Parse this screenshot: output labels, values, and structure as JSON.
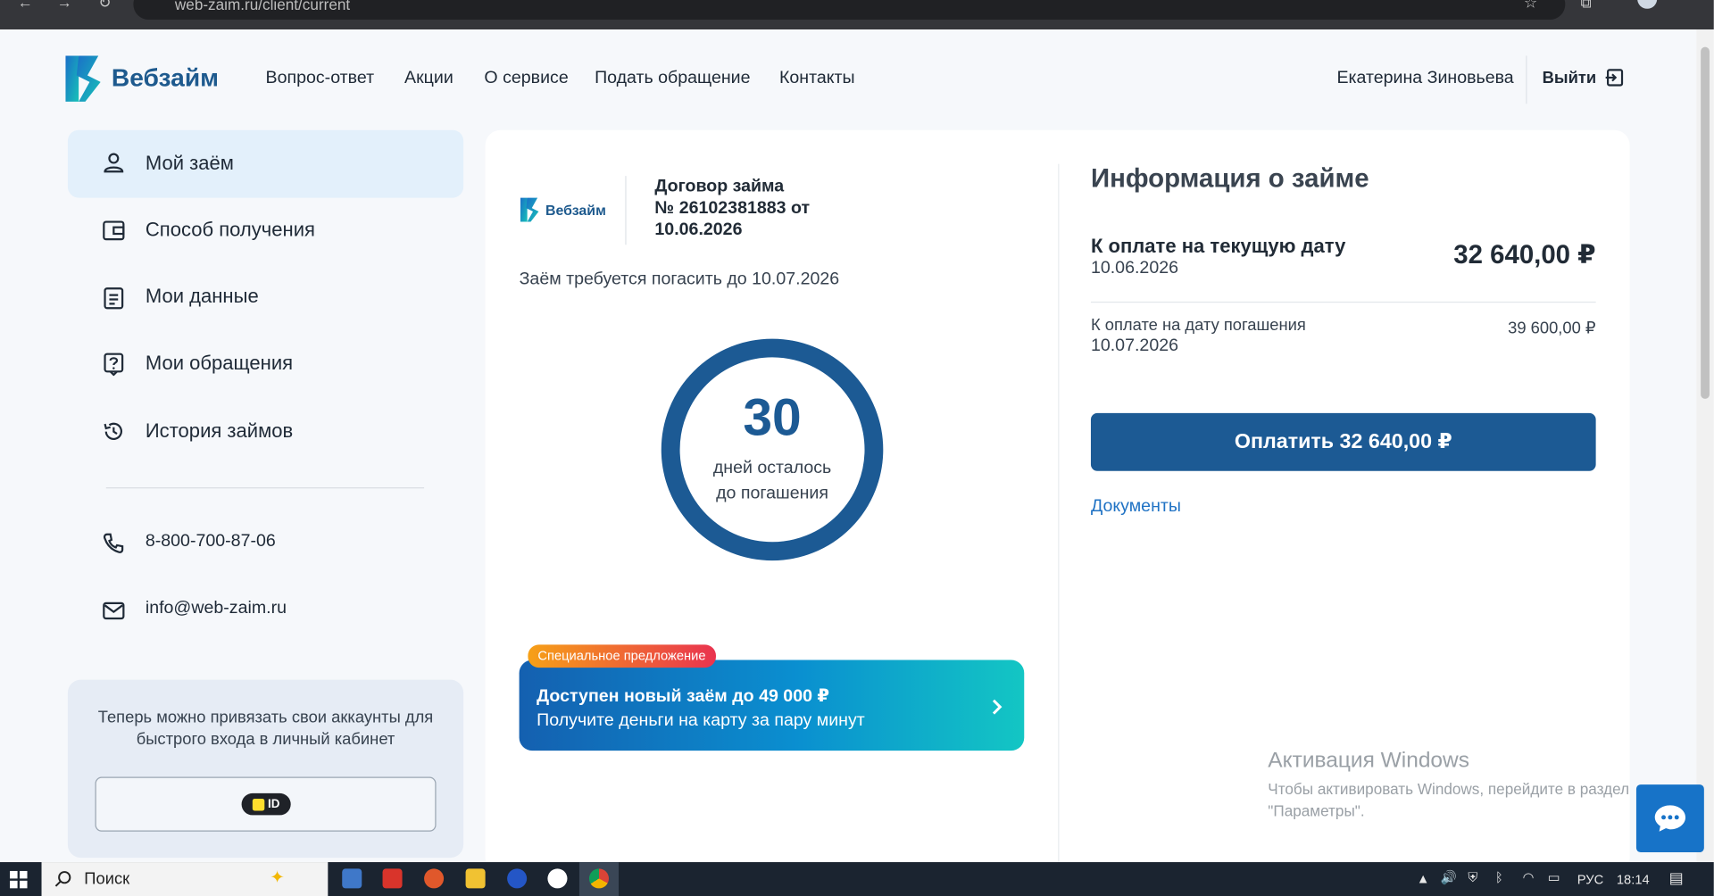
{
  "browser": {
    "url": "web-zaim.ru/client/current"
  },
  "header": {
    "brand": "Вебзайм",
    "nav": [
      "Вопрос-ответ",
      "Акции",
      "О сервисе",
      "Подать обращение",
      "Контакты"
    ],
    "user_name": "Екатерина Зиновьева",
    "logout_label": "Выйти"
  },
  "sidebar": {
    "items": [
      {
        "label": "Мой заём",
        "icon": "user-icon"
      },
      {
        "label": "Способ получения",
        "icon": "wallet-icon"
      },
      {
        "label": "Мои данные",
        "icon": "clipboard-icon"
      },
      {
        "label": "Мои обращения",
        "icon": "question-icon"
      },
      {
        "label": "История займов",
        "icon": "history-icon"
      }
    ],
    "phone": "8-800-700-87-06",
    "email": "info@web-zaim.ru",
    "link_accounts_text": "Теперь можно привязать свои аккаунты для быстрого входа в личный кабинет",
    "tid_label": "ID"
  },
  "contract": {
    "brand": "Вебзайм",
    "title_line1": "Договор займа",
    "title_line2": "№ 26102381883 от",
    "title_line3": "10.06.2026",
    "repay_by": "Заём требуется погасить до 10.07.2026",
    "days_left": "30",
    "days_left_line1": "дней осталось",
    "days_left_line2": "до погашения"
  },
  "offer": {
    "badge": "Специальное предложение",
    "title": "Доступен новый заём до 49 000 ₽",
    "subtitle": "Получите деньги на карту за пару минут"
  },
  "info": {
    "title": "Информация о займе",
    "current_label": "К оплате на текущую дату",
    "current_date": "10.06.2026",
    "current_amount": "32 640,00 ₽",
    "due_label": "К оплате на дату погашения",
    "due_date": "10.07.2026",
    "due_amount": "39 600,00 ₽",
    "pay_button": "Оплатить 32 640,00 ₽",
    "documents_link": "Документы"
  },
  "watermark": {
    "title": "Активация Windows",
    "line1": "Чтобы активировать Windows, перейдите в раздел",
    "line2": "\"Параметры\"."
  },
  "taskbar": {
    "search": "Поиск",
    "lang": "РУС",
    "time": "18:14"
  },
  "colors": {
    "primary": "#1c5a94",
    "accent": "#1f72c4",
    "page_bg": "#f6f8fb",
    "sidebar_active": "#e3f0fb"
  }
}
